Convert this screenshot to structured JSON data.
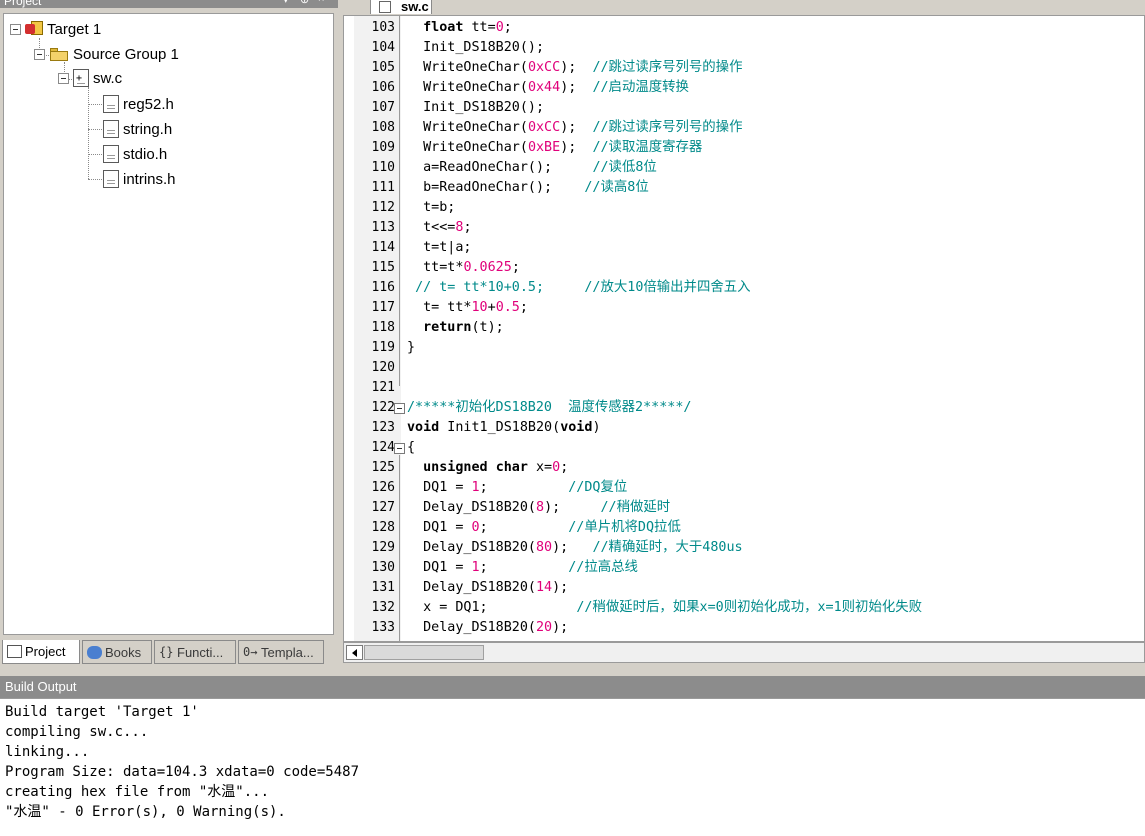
{
  "project_panel": {
    "title": "Project",
    "tree": {
      "target": "Target 1",
      "group": "Source Group 1",
      "file": "sw.c",
      "includes": [
        "reg52.h",
        "string.h",
        "stdio.h",
        "intrins.h"
      ]
    },
    "tabs": [
      "Project",
      "Books",
      "Functi...",
      "Templa..."
    ]
  },
  "editor": {
    "tab_label": "sw.c",
    "lines": [
      {
        "n": "103",
        "code": [
          {
            "t": "  "
          },
          {
            "t": "float",
            "c": "kw"
          },
          {
            "t": " tt="
          },
          {
            "t": "0",
            "c": "num"
          },
          {
            "t": ";"
          }
        ]
      },
      {
        "n": "104",
        "code": [
          {
            "t": "  Init_DS18B20();"
          }
        ]
      },
      {
        "n": "105",
        "code": [
          {
            "t": "  WriteOneChar("
          },
          {
            "t": "0xCC",
            "c": "num"
          },
          {
            "t": ");  "
          },
          {
            "t": "//跳过读序号列号的操作",
            "c": "cm"
          }
        ]
      },
      {
        "n": "106",
        "code": [
          {
            "t": "  WriteOneChar("
          },
          {
            "t": "0x44",
            "c": "num"
          },
          {
            "t": ");  "
          },
          {
            "t": "//启动温度转换",
            "c": "cm"
          }
        ]
      },
      {
        "n": "107",
        "code": [
          {
            "t": "  Init_DS18B20();"
          }
        ]
      },
      {
        "n": "108",
        "code": [
          {
            "t": "  WriteOneChar("
          },
          {
            "t": "0xCC",
            "c": "num"
          },
          {
            "t": ");  "
          },
          {
            "t": "//跳过读序号列号的操作",
            "c": "cm"
          }
        ]
      },
      {
        "n": "109",
        "code": [
          {
            "t": "  WriteOneChar("
          },
          {
            "t": "0xBE",
            "c": "num"
          },
          {
            "t": ");  "
          },
          {
            "t": "//读取温度寄存器",
            "c": "cm"
          }
        ]
      },
      {
        "n": "110",
        "code": [
          {
            "t": "  a=ReadOneChar();     "
          },
          {
            "t": "//读低8位",
            "c": "cm"
          }
        ]
      },
      {
        "n": "111",
        "code": [
          {
            "t": "  b=ReadOneChar();    "
          },
          {
            "t": "//读高8位",
            "c": "cm"
          }
        ]
      },
      {
        "n": "112",
        "code": [
          {
            "t": "  t=b;"
          }
        ]
      },
      {
        "n": "113",
        "code": [
          {
            "t": "  t<<="
          },
          {
            "t": "8",
            "c": "num"
          },
          {
            "t": ";"
          }
        ]
      },
      {
        "n": "114",
        "code": [
          {
            "t": "  t=t|a;"
          }
        ]
      },
      {
        "n": "115",
        "code": [
          {
            "t": "  tt=t*"
          },
          {
            "t": "0.0625",
            "c": "num"
          },
          {
            "t": ";"
          }
        ]
      },
      {
        "n": "116",
        "code": [
          {
            "t": " "
          },
          {
            "t": "// t= tt*10+0.5;     //放大10倍输出并四舍五入",
            "c": "cm"
          }
        ]
      },
      {
        "n": "117",
        "code": [
          {
            "t": "  t= tt*"
          },
          {
            "t": "10",
            "c": "num"
          },
          {
            "t": "+"
          },
          {
            "t": "0.5",
            "c": "num"
          },
          {
            "t": ";"
          }
        ]
      },
      {
        "n": "118",
        "code": [
          {
            "t": "  "
          },
          {
            "t": "return",
            "c": "kw"
          },
          {
            "t": "(t);"
          }
        ]
      },
      {
        "n": "119",
        "code": [
          {
            "t": "}"
          }
        ]
      },
      {
        "n": "120",
        "code": []
      },
      {
        "n": "121",
        "code": []
      },
      {
        "n": "122",
        "code": [
          {
            "t": "/*****初始化DS18B20  温度传感器2*****/",
            "c": "cm"
          }
        ]
      },
      {
        "n": "123",
        "code": [
          {
            "t": "void",
            "c": "kw"
          },
          {
            "t": " Init1_DS18B20("
          },
          {
            "t": "void",
            "c": "kw"
          },
          {
            "t": ")"
          }
        ]
      },
      {
        "n": "124",
        "code": [
          {
            "t": "{"
          }
        ]
      },
      {
        "n": "125",
        "code": [
          {
            "t": "  "
          },
          {
            "t": "unsigned",
            "c": "kw"
          },
          {
            "t": " "
          },
          {
            "t": "char",
            "c": "kw"
          },
          {
            "t": " x="
          },
          {
            "t": "0",
            "c": "num"
          },
          {
            "t": ";"
          }
        ]
      },
      {
        "n": "126",
        "code": [
          {
            "t": "  DQ1 = "
          },
          {
            "t": "1",
            "c": "num"
          },
          {
            "t": ";          "
          },
          {
            "t": "//DQ复位",
            "c": "cm"
          }
        ]
      },
      {
        "n": "127",
        "code": [
          {
            "t": "  Delay_DS18B20("
          },
          {
            "t": "8",
            "c": "num"
          },
          {
            "t": ");     "
          },
          {
            "t": "//稍做延时",
            "c": "cm"
          }
        ]
      },
      {
        "n": "128",
        "code": [
          {
            "t": "  DQ1 = "
          },
          {
            "t": "0",
            "c": "num"
          },
          {
            "t": ";          "
          },
          {
            "t": "//单片机将DQ拉低",
            "c": "cm"
          }
        ]
      },
      {
        "n": "129",
        "code": [
          {
            "t": "  Delay_DS18B20("
          },
          {
            "t": "80",
            "c": "num"
          },
          {
            "t": ");   "
          },
          {
            "t": "//精确延时，大于480us",
            "c": "cm"
          }
        ]
      },
      {
        "n": "130",
        "code": [
          {
            "t": "  DQ1 = "
          },
          {
            "t": "1",
            "c": "num"
          },
          {
            "t": ";          "
          },
          {
            "t": "//拉高总线",
            "c": "cm"
          }
        ]
      },
      {
        "n": "131",
        "code": [
          {
            "t": "  Delay_DS18B20("
          },
          {
            "t": "14",
            "c": "num"
          },
          {
            "t": ");"
          }
        ]
      },
      {
        "n": "132",
        "code": [
          {
            "t": "  x = DQ1;           "
          },
          {
            "t": "//稍做延时后，如果x=0则初始化成功，x=1则初始化失败",
            "c": "cm"
          }
        ]
      },
      {
        "n": "133",
        "code": [
          {
            "t": "  Delay_DS18B20("
          },
          {
            "t": "20",
            "c": "num"
          },
          {
            "t": ");"
          }
        ]
      }
    ]
  },
  "build_output": {
    "title": "Build Output",
    "lines": [
      "Build target 'Target 1'",
      "compiling sw.c...",
      "linking...",
      "Program Size: data=104.3 xdata=0 code=5487",
      "creating hex file from \"水温\"...",
      "\"水温\" - 0 Error(s), 0 Warning(s)."
    ]
  },
  "colors": {
    "keyword": "#000000",
    "number": "#e0007a",
    "comment": "#008a8a",
    "panel_title": "#8c8c8c"
  }
}
